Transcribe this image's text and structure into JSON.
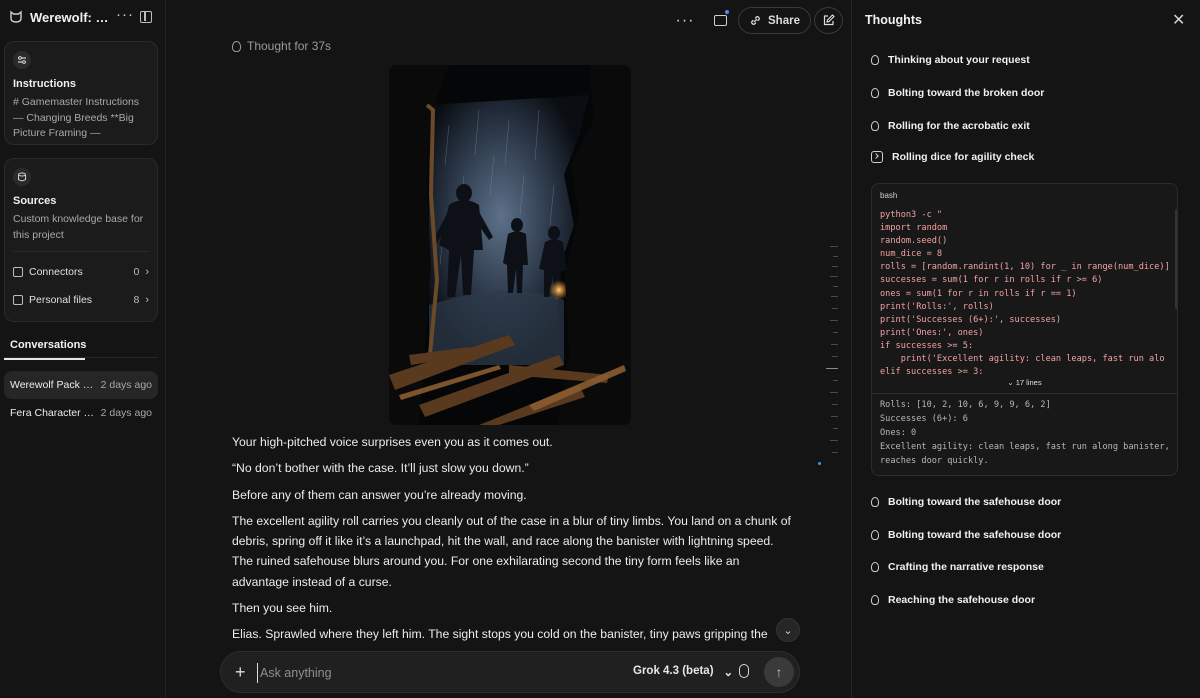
{
  "sidebar": {
    "title": "Werewolf: th…",
    "instructions": {
      "title": "Instructions",
      "text": "# Gamemaster Instructions — Changing Breeds **Big Picture Framing — Welcom…"
    },
    "sources": {
      "title": "Sources",
      "text": "Custom knowledge base for this project",
      "rows": [
        {
          "label": "Connectors",
          "count": "0"
        },
        {
          "label": "Personal files",
          "count": "8"
        }
      ]
    },
    "conversations_tab": "Conversations",
    "conversations": [
      {
        "name": "Werewolf Pack …",
        "date": "2 days ago"
      },
      {
        "name": "Fera Character …",
        "date": "2 days ago"
      }
    ]
  },
  "topbar": {
    "share_label": "Share"
  },
  "main": {
    "thought_label": "Thought for 37s",
    "paragraphs": [
      "Your high-pitched voice surprises even you as it comes out.",
      "“No don’t bother with the case. It’ll just slow you down.”",
      "Before any of them can answer you’re already moving.",
      "The excellent agility roll carries you cleanly out of the case in a blur of tiny limbs. You land on a chunk of debris, spring off it like it’s a launchpad, hit the wall, and race along the banister with lightning speed. The ruined safehouse blurs around you. For one exhilarating second the tiny form feels like an advantage instead of a curse.",
      "Then you see him.",
      "Elias. Sprawled where they left him. The sight stops you cold on the banister, tiny paws gripping the"
    ],
    "composer": {
      "placeholder": "Ask anything",
      "model": "Grok 4.3 (beta)"
    }
  },
  "thoughts": {
    "title": "Thoughts",
    "steps_before": [
      {
        "label": "Thinking about your request",
        "icon": "bulb-icon"
      },
      {
        "label": "Bolting toward the broken door",
        "icon": "bulb-icon"
      },
      {
        "label": "Rolling for the acrobatic exit",
        "icon": "bulb-icon"
      },
      {
        "label": "Rolling dice for agility check",
        "icon": "terminal-icon"
      }
    ],
    "code": {
      "lang": "bash",
      "lines": "python3 -c \"\nimport random\nrandom.seed()\nnum_dice = 8\nrolls = [random.randint(1, 10) for _ in range(num_dice)]\nsuccesses = sum(1 for r in rolls if r >= 6)\nones = sum(1 for r in rolls if r == 1)\nprint('Rolls:', rolls)\nprint('Successes (6+):', successes)\nprint('Ones:', ones)\nif successes >= 5:\n    print('Excellent agility: clean leaps, fast run alo\nelif successes >= 3:",
      "expand_label": "17 lines",
      "output": "Rolls: [10, 2, 10, 6, 9, 9, 6, 2]\nSuccesses (6+): 6\nOnes: 0\nExcellent agility: clean leaps, fast run along banister, reaches door quickly."
    },
    "steps_after": [
      {
        "label": "Bolting toward the safehouse door"
      },
      {
        "label": "Bolting toward the safehouse door"
      },
      {
        "label": "Crafting the narrative response"
      },
      {
        "label": "Reaching the safehouse door"
      }
    ]
  }
}
